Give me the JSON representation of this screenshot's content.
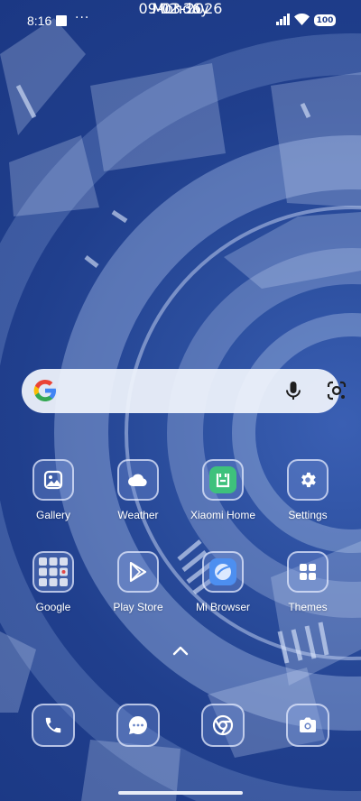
{
  "status_bar": {
    "time": "8:16",
    "more": "···",
    "battery": "100"
  },
  "clock": {
    "time": "02:36",
    "date": "09-03-2026",
    "day": "Monday"
  },
  "search_bar": {},
  "apps_row1": [
    {
      "label": "Gallery",
      "icon": "gallery-icon"
    },
    {
      "label": "Weather",
      "icon": "cloud-icon"
    },
    {
      "label": "Xiaomi Home",
      "icon": "xiaomi-home-icon"
    },
    {
      "label": "Settings",
      "icon": "gear-icon"
    }
  ],
  "apps_row2": [
    {
      "label": "Google",
      "icon": "folder-icon"
    },
    {
      "label": "Play Store",
      "icon": "play-store-icon"
    },
    {
      "label": "Mi Browser",
      "icon": "browser-icon"
    },
    {
      "label": "Themes",
      "icon": "themes-icon"
    }
  ],
  "dock": [
    {
      "icon": "phone-icon"
    },
    {
      "icon": "messages-icon"
    },
    {
      "icon": "chrome-icon"
    },
    {
      "icon": "camera-icon"
    }
  ],
  "colors": {
    "background": "#203f8d",
    "xiaomi_green": "#3ec17c",
    "browser_blue": "#4d8ff0"
  }
}
